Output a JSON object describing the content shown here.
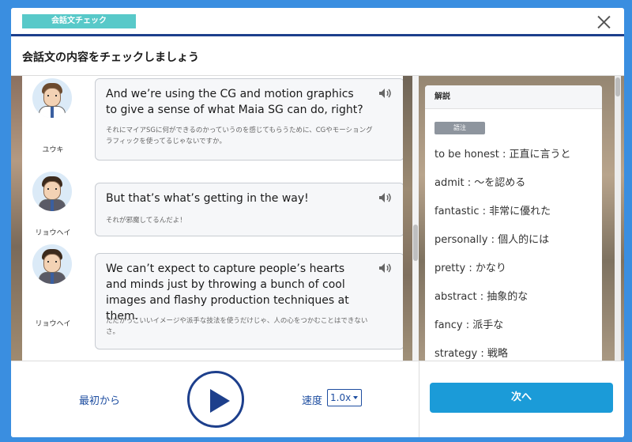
{
  "header": {
    "tag": "会話文チェック",
    "title": "会話文の内容をチェックしましょう"
  },
  "conversation": [
    {
      "speaker": "ユウキ",
      "en": "And we’re using the CG and motion graphics to give a sense of what Maia SG can do, right?",
      "jp": "それにマイアSGに何ができるのかっていうのを感じてもらうために、CGやモーショングラフィックを使ってるじゃないですか。"
    },
    {
      "speaker": "リョウヘイ",
      "en": "But that’s what’s getting in the way!",
      "jp": "それが邪魔してるんだよ！"
    },
    {
      "speaker": "リョウヘイ",
      "en": "We can’t expect to capture people’s hearts and minds just by throwing a bunch of cool images and flashy production techniques at them.",
      "jp": "ただかっこいいイメージや派手な技法を使うだけじゃ、人の心をつかむことはできないさ。"
    }
  ],
  "panel": {
    "title": "解説",
    "badge": "語注",
    "vocab": [
      "to be honest : 正直に言うと",
      "admit : 〜を認める",
      "fantastic : 非常に優れた",
      "personally : 個人的には",
      "pretty : かなり",
      "abstract : 抽象的な",
      "fancy : 派手な",
      "strategy : 戦略"
    ]
  },
  "footer": {
    "restart": "最初から",
    "speed_label": "速度",
    "speed_value": "1.0x",
    "next": "次へ"
  },
  "icons": {
    "close": "close-icon",
    "audio": "speaker-icon",
    "play": "play-icon",
    "dropdown": "caret-down-icon"
  },
  "colors": {
    "brand_blue": "#1d3f8c",
    "link_blue": "#1d4da0",
    "tag_teal": "#58c9c9",
    "button_blue": "#1b9bd8"
  }
}
